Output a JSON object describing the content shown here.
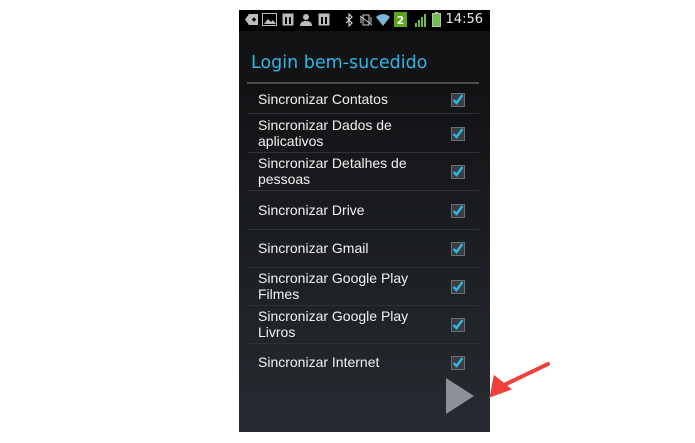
{
  "status_bar": {
    "time": "14:56",
    "notification_badge": "2",
    "icons": [
      "add-icon",
      "image-icon",
      "calendar-icon",
      "person-icon",
      "calendar-icon",
      "bluetooth-icon",
      "vibrate-icon",
      "wifi-icon",
      "battery-badge-icon",
      "signal-icon",
      "battery-icon"
    ]
  },
  "header": {
    "title": "Login bem-sucedido"
  },
  "sync_list": {
    "items": [
      {
        "label": "Sincronizar Contatos",
        "checked": true
      },
      {
        "label": "Sincronizar Dados de aplicativos",
        "checked": true
      },
      {
        "label": "Sincronizar Detalhes de pessoas",
        "checked": true
      },
      {
        "label": "Sincronizar Drive",
        "checked": true
      },
      {
        "label": "Sincronizar Gmail",
        "checked": true
      },
      {
        "label": "Sincronizar Google Play Filmes",
        "checked": true
      },
      {
        "label": "Sincronizar Google Play Livros",
        "checked": true
      },
      {
        "label": "Sincronizar Internet",
        "checked": true
      }
    ]
  },
  "footer": {
    "next_icon": "play-triangle-icon"
  },
  "annotation": {
    "arrow_icon": "red-arrow-icon",
    "color": "#f0403c"
  },
  "colors": {
    "accent": "#33b5e5",
    "checkbox_check": "#33b5e5",
    "background": "#0e0f11"
  }
}
